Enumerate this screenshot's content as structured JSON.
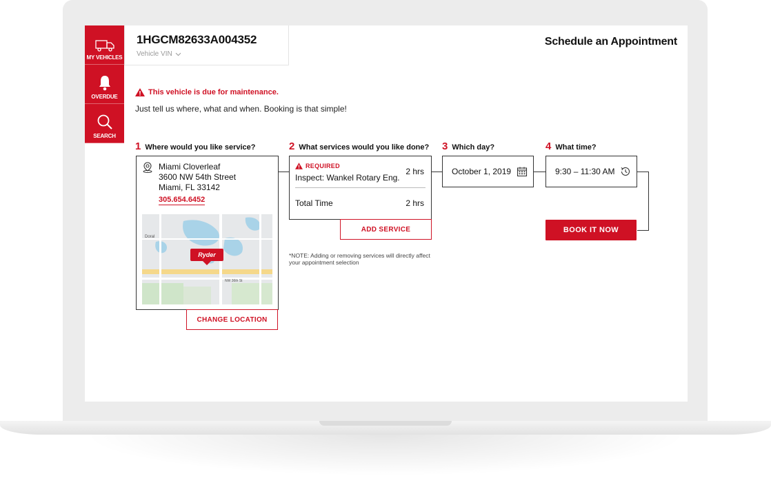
{
  "colors": {
    "brand": "#cf1124",
    "text": "#111111"
  },
  "sidebar": {
    "items": [
      {
        "label": "MY VEHICLES",
        "icon": "truck-icon"
      },
      {
        "label": "OVERDUE",
        "icon": "bell-icon"
      },
      {
        "label": "SEARCH",
        "icon": "search-icon"
      }
    ]
  },
  "vehicle": {
    "vin": "1HGCM82633A004352",
    "vin_label": "Vehicle VIN"
  },
  "page_title": "Schedule an Appointment",
  "alert": "This vehicle is due for maintenance.",
  "intro": "Just tell us where, what and when.  Booking is that simple!",
  "steps": [
    {
      "num": "1",
      "label": "Where would you like service?"
    },
    {
      "num": "2",
      "label": "What services would you like done?"
    },
    {
      "num": "3",
      "label": "Which day?"
    },
    {
      "num": "4",
      "label": "What time?"
    }
  ],
  "location": {
    "name": "Miami Cloverleaf",
    "street": "3600 NW 54th Street",
    "city": "Miami, FL 33142",
    "phone": "305.654.6452",
    "map_label_city": "Doral",
    "map_brand": "Ryder",
    "map_street": "NW 36th St",
    "change_button": "CHANGE LOCATION"
  },
  "services": {
    "required_label": "REQUIRED",
    "item": "Inspect: Wankel Rotary Eng.",
    "item_hrs": "2 hrs",
    "total_label": "Total Time",
    "total_hrs": "2 hrs",
    "add_button": "ADD SERVICE",
    "note": "*NOTE: Adding or removing services will directly affect your appointment selection"
  },
  "day": {
    "value": "October 1, 2019"
  },
  "time": {
    "value": "9:30 – 11:30 AM",
    "book_button": "BOOK IT NOW"
  }
}
